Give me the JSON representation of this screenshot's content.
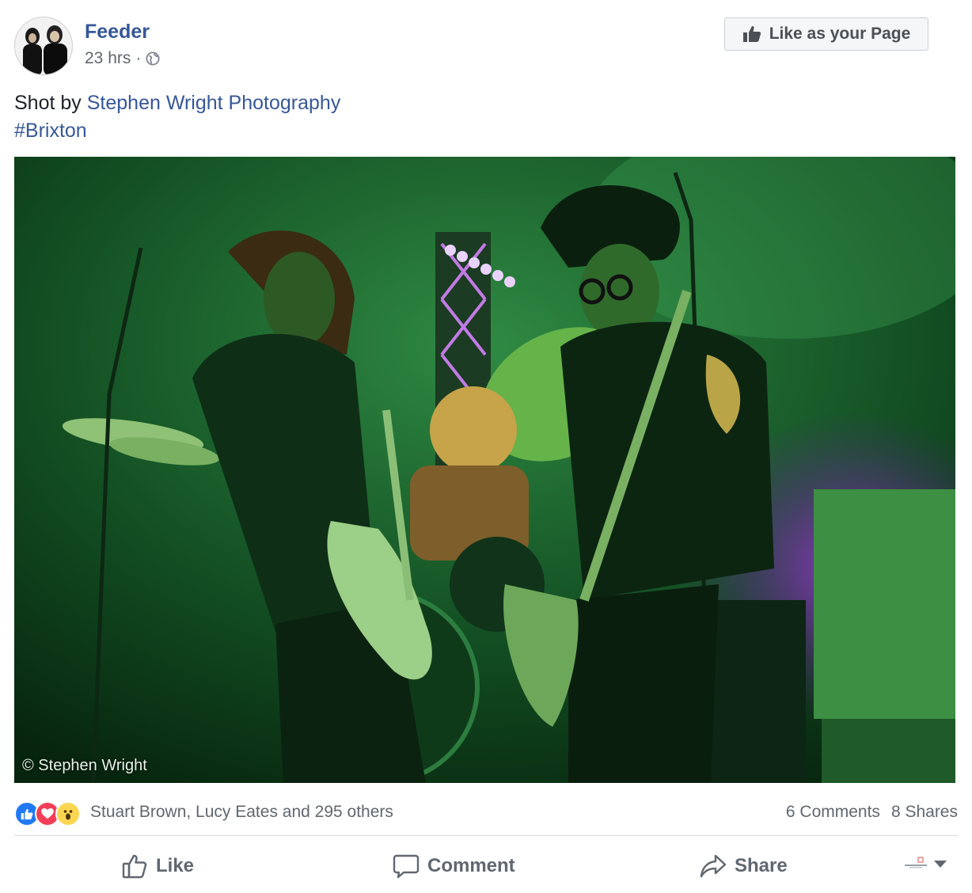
{
  "post": {
    "page_name": "Feeder",
    "timestamp": "23 hrs",
    "separator": "·",
    "privacy_icon": "globe-icon",
    "like_page_button": "Like as your Page",
    "text_prefix": "Shot by ",
    "text_link": "Stephen Wright Photography",
    "hashtag": "#Brixton",
    "photo_watermark": "© Stephen Wright"
  },
  "engagement": {
    "reactions": [
      "like-reaction-icon",
      "love-reaction-icon",
      "wow-reaction-icon"
    ],
    "reactors": "Stuart Brown, Lucy Eates and 295 others",
    "comments": "6 Comments",
    "shares": "8 Shares"
  },
  "actions": {
    "like": "Like",
    "comment": "Comment",
    "share": "Share"
  },
  "colors": {
    "link": "#365899",
    "secondary_text": "#616770",
    "like_blue": "#2078f4",
    "love_red": "#f33e58",
    "wow_yellow": "#fcd651"
  }
}
